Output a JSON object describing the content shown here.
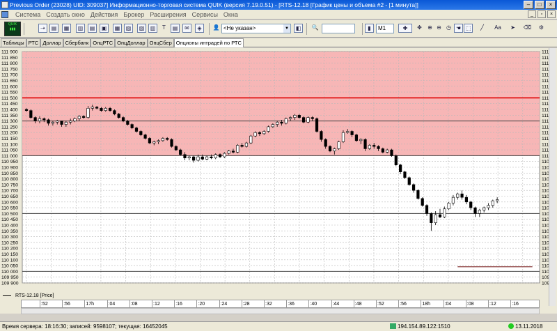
{
  "window": {
    "title": "Previous Order (23028) UID: 309037] Информационно-торговая система QUIK (версия 7.19.0.51) - [RTS-12.18 [График цены и объема #2 - [1 минута]]",
    "minimize": "–",
    "maximize": "□",
    "close": "×"
  },
  "menu": {
    "items": [
      "Система",
      "Создать окно",
      "Действия",
      "Брокер",
      "Расширения",
      "Сервисы",
      "Окна"
    ]
  },
  "toolbar": {
    "account_select": "<Не указан>",
    "interval": "M1",
    "search_value": ""
  },
  "tabs": [
    "Таблицы",
    "РТС",
    "Доллар",
    "Сбербанк",
    "ОпцРТС",
    "ОпцДоллар",
    "ОпцСбер",
    "Опционы интрадей по РТС"
  ],
  "active_tab": 7,
  "chart_data": {
    "type": "candlestick",
    "series_name": "RTS-12.18 [Price]",
    "ylim": [
      109900,
      111900
    ],
    "y_ticks": [
      109900,
      109950,
      110000,
      110050,
      110100,
      110150,
      110200,
      110250,
      110300,
      110350,
      110400,
      110450,
      110500,
      110550,
      110600,
      110650,
      110700,
      110750,
      110800,
      110850,
      110900,
      110950,
      111000,
      111050,
      111100,
      111150,
      111200,
      111250,
      111300,
      111350,
      111400,
      111450,
      111500,
      111550,
      111600,
      111650,
      111700,
      111750,
      111800,
      111850,
      111900
    ],
    "y_tick_labels": [
      "109 900",
      "109 950",
      "110 000",
      "110 050",
      "110 100",
      "110 150",
      "110 200",
      "110 250",
      "110 300",
      "110 350",
      "110 400",
      "110 450",
      "110 500",
      "110 550",
      "110 600",
      "110 650",
      "110 700",
      "110 750",
      "110 800",
      "110 850",
      "110 900",
      "110 950",
      "111 000",
      "111 050",
      "111 100",
      "111 150",
      "111 200",
      "111 250",
      "111 300",
      "111 350",
      "111 400",
      "111 450",
      "111 500",
      "111 550",
      "111 600",
      "111 650",
      "111 700",
      "111 750",
      "111 800",
      "111 850",
      "111 900"
    ],
    "right_y_labels": [
      {
        "value": 110630,
        "label": "110 630"
      },
      {
        "value": 110600,
        "label": "110 600"
      }
    ],
    "shaded_zone": {
      "from": 111000,
      "to": 111900,
      "color": "#f7b6b6"
    },
    "lines": [
      {
        "value": 111500,
        "color": "#e00000"
      },
      {
        "value": 111300,
        "color": "#404040"
      },
      {
        "value": 111000,
        "color": "#404040"
      },
      {
        "value": 110500,
        "color": "#404040"
      },
      {
        "value": 110000,
        "color": "#404040"
      }
    ],
    "segments": [
      {
        "value": 110780,
        "from": 122,
        "to": 138,
        "color": "#a06060"
      },
      {
        "value": 110040,
        "from": 98,
        "to": 115,
        "color": "#a06060"
      }
    ],
    "candles": [
      [
        111400,
        111410,
        111380,
        111390
      ],
      [
        111390,
        111400,
        111320,
        111330
      ],
      [
        111330,
        111340,
        111280,
        111300
      ],
      [
        111300,
        111340,
        111280,
        111320
      ],
      [
        111320,
        111330,
        111290,
        111310
      ],
      [
        111310,
        111320,
        111260,
        111280
      ],
      [
        111280,
        111300,
        111260,
        111290
      ],
      [
        111290,
        111310,
        111270,
        111300
      ],
      [
        111300,
        111300,
        111250,
        111270
      ],
      [
        111270,
        111300,
        111250,
        111290
      ],
      [
        111290,
        111320,
        111270,
        111300
      ],
      [
        111300,
        111330,
        111290,
        111320
      ],
      [
        111320,
        111350,
        111300,
        111340
      ],
      [
        111340,
        111350,
        111320,
        111330
      ],
      [
        111330,
        111430,
        111320,
        111410
      ],
      [
        111410,
        111440,
        111390,
        111420
      ],
      [
        111420,
        111430,
        111400,
        111410
      ],
      [
        111410,
        111420,
        111380,
        111390
      ],
      [
        111390,
        111420,
        111380,
        111410
      ],
      [
        111410,
        111420,
        111380,
        111390
      ],
      [
        111390,
        111400,
        111350,
        111360
      ],
      [
        111360,
        111370,
        111320,
        111330
      ],
      [
        111330,
        111340,
        111290,
        111300
      ],
      [
        111300,
        111310,
        111260,
        111270
      ],
      [
        111270,
        111280,
        111230,
        111240
      ],
      [
        111240,
        111250,
        111200,
        111210
      ],
      [
        111210,
        111220,
        111170,
        111180
      ],
      [
        111180,
        111190,
        111140,
        111150
      ],
      [
        111150,
        111160,
        111100,
        111110
      ],
      [
        111110,
        111130,
        111090,
        111120
      ],
      [
        111120,
        111140,
        111100,
        111130
      ],
      [
        111130,
        111160,
        111120,
        111150
      ],
      [
        111150,
        111160,
        111130,
        111140
      ],
      [
        111140,
        111150,
        111070,
        111080
      ],
      [
        111080,
        111090,
        111040,
        111050
      ],
      [
        111050,
        111060,
        111000,
        111010
      ],
      [
        111010,
        111030,
        110960,
        110980
      ],
      [
        110980,
        111000,
        110960,
        110990
      ],
      [
        110990,
        111000,
        110940,
        110960
      ],
      [
        110960,
        111010,
        110950,
        110990
      ],
      [
        110990,
        111010,
        110960,
        110970
      ],
      [
        110970,
        111000,
        110960,
        110990
      ],
      [
        110990,
        111010,
        110970,
        110980
      ],
      [
        110980,
        111020,
        110970,
        111010
      ],
      [
        111010,
        111020,
        110980,
        110990
      ],
      [
        110990,
        111030,
        110980,
        111020
      ],
      [
        111020,
        111050,
        111010,
        111040
      ],
      [
        111040,
        111060,
        111020,
        111030
      ],
      [
        111030,
        111100,
        111020,
        111090
      ],
      [
        111090,
        111110,
        111070,
        111080
      ],
      [
        111080,
        111120,
        111070,
        111110
      ],
      [
        111110,
        111180,
        111100,
        111170
      ],
      [
        111170,
        111210,
        111160,
        111200
      ],
      [
        111200,
        111210,
        111170,
        111190
      ],
      [
        111190,
        111220,
        111180,
        111210
      ],
      [
        111210,
        111260,
        111200,
        111250
      ],
      [
        111250,
        111280,
        111240,
        111270
      ],
      [
        111270,
        111300,
        111250,
        111290
      ],
      [
        111290,
        111310,
        111260,
        111280
      ],
      [
        111280,
        111330,
        111270,
        111320
      ],
      [
        111320,
        111340,
        111300,
        111330
      ],
      [
        111330,
        111360,
        111310,
        111350
      ],
      [
        111350,
        111360,
        111320,
        111330
      ],
      [
        111330,
        111340,
        111280,
        111290
      ],
      [
        111290,
        111340,
        111280,
        111330
      ],
      [
        111330,
        111340,
        111300,
        111320
      ],
      [
        111320,
        111330,
        111200,
        111210
      ],
      [
        111210,
        111220,
        111120,
        111140
      ],
      [
        111140,
        111150,
        111060,
        111080
      ],
      [
        111080,
        111090,
        111030,
        111040
      ],
      [
        111040,
        111070,
        111010,
        111060
      ],
      [
        111060,
        111130,
        111050,
        111120
      ],
      [
        111120,
        111220,
        111110,
        111200
      ],
      [
        111200,
        111230,
        111190,
        111210
      ],
      [
        111210,
        111220,
        111160,
        111180
      ],
      [
        111180,
        111190,
        111120,
        111130
      ],
      [
        111130,
        111150,
        111100,
        111140
      ],
      [
        111140,
        111150,
        111040,
        111060
      ],
      [
        111060,
        111100,
        111050,
        111090
      ],
      [
        111090,
        111110,
        111060,
        111080
      ],
      [
        111080,
        111090,
        111040,
        111060
      ],
      [
        111060,
        111070,
        111020,
        111030
      ],
      [
        111030,
        111060,
        111020,
        111050
      ],
      [
        111050,
        111060,
        110990,
        111000
      ],
      [
        111000,
        111010,
        110910,
        110920
      ],
      [
        110920,
        110930,
        110840,
        110860
      ],
      [
        110860,
        110870,
        110800,
        110810
      ],
      [
        110810,
        110820,
        110740,
        110750
      ],
      [
        110750,
        110760,
        110680,
        110700
      ],
      [
        110700,
        110710,
        110620,
        110630
      ],
      [
        110630,
        110640,
        110560,
        110570
      ],
      [
        110570,
        110580,
        110480,
        110500
      ],
      [
        110500,
        110510,
        110350,
        110420
      ],
      [
        110420,
        110520,
        110400,
        110490
      ],
      [
        110490,
        110540,
        110460,
        110470
      ],
      [
        110470,
        110560,
        110460,
        110540
      ],
      [
        110540,
        110600,
        110530,
        110590
      ],
      [
        110590,
        110660,
        110570,
        110640
      ],
      [
        110640,
        110680,
        110620,
        110670
      ],
      [
        110670,
        110700,
        110620,
        110640
      ],
      [
        110640,
        110660,
        110580,
        110600
      ],
      [
        110600,
        110610,
        110530,
        110550
      ],
      [
        110550,
        110560,
        110470,
        110500
      ],
      [
        110500,
        110540,
        110470,
        110530
      ],
      [
        110530,
        110560,
        110510,
        110550
      ],
      [
        110550,
        110590,
        110530,
        110570
      ],
      [
        110570,
        110620,
        110550,
        110610
      ],
      [
        110610,
        110640,
        110590,
        110620
      ]
    ],
    "time_labels": [
      ":52",
      ":56",
      "17h",
      ":04",
      ":08",
      ":12",
      ":16",
      ":20",
      ":24",
      ":28",
      ":32",
      ":36",
      ":40",
      ":44",
      ":48",
      ":52",
      ":56",
      "18h",
      ":04",
      ":08",
      ":12",
      ":16"
    ]
  },
  "status": {
    "server_time": "Время сервера: 18:16:30; записей: 9598107; текущая: 16452045",
    "connection": "194.154.89.122:1510",
    "date": "13.11.2018"
  }
}
